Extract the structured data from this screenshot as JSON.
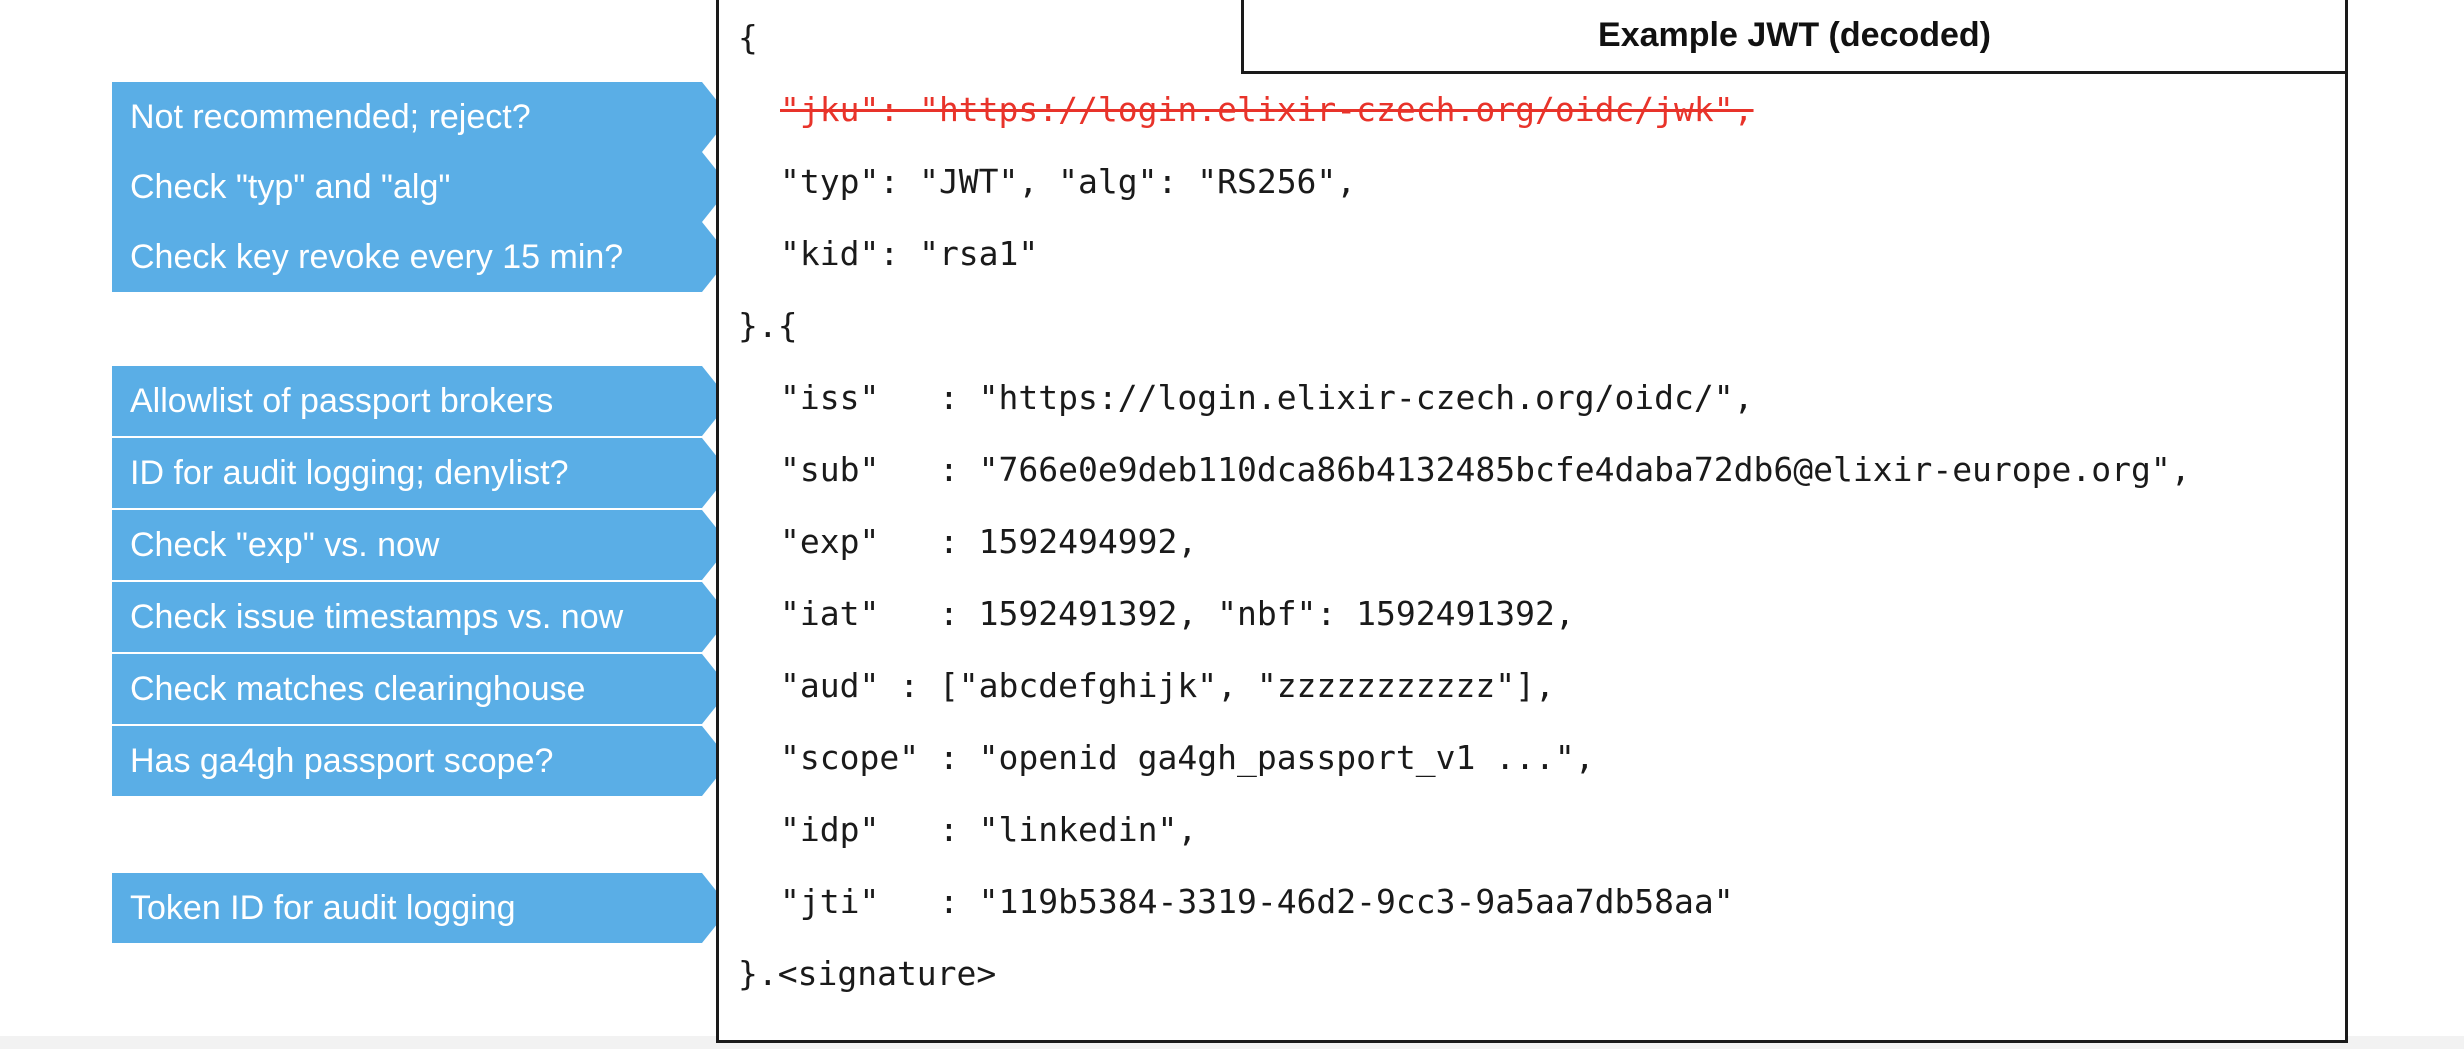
{
  "title": "Example JWT (decoded)",
  "callouts": [
    "Not recommended; reject?",
    "Check \"typ\" and \"alg\"",
    "Check key revoke every 15 min?",
    "Allowlist of passport brokers",
    "ID for audit logging; denylist?",
    "Check \"exp\" vs. now",
    "Check issue timestamps vs. now",
    "Check matches clearinghouse",
    "Has ga4gh passport scope?",
    "Token ID for audit logging"
  ],
  "code": {
    "open_brace": "{",
    "jku": "\"jku\": \"https://login.elixir-czech.org/oidc/jwk\",",
    "typ_alg": "\"typ\": \"JWT\", \"alg\": \"RS256\",",
    "kid": "\"kid\": \"rsa1\"",
    "mid": "}.{",
    "iss": "\"iss\"   : \"https://login.elixir-czech.org/oidc/\",",
    "sub": "\"sub\"   : \"766e0e9deb110dca86b4132485bcfe4daba72db6@elixir-europe.org\",",
    "exp": "\"exp\"   : 1592494992,",
    "iat": "\"iat\"   : 1592491392, \"nbf\": 1592491392,",
    "aud": "\"aud\" : [\"abcdefghijk\", \"zzzzzzzzzzz\"],",
    "scope": "\"scope\" : \"openid ga4gh_passport_v1 ...\",",
    "idp": "\"idp\"   : \"linkedin\",",
    "jti": "\"jti\"   : \"119b5384-3319-46d2-9cc3-9a5aa7db58aa\"",
    "end": "}.<signature>"
  }
}
